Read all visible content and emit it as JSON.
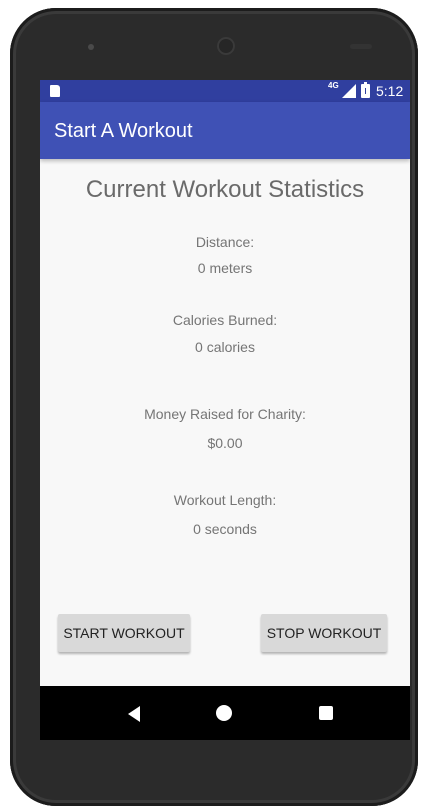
{
  "status_bar": {
    "network": "4G",
    "time": "5:12"
  },
  "app_bar": {
    "title": "Start A Workout"
  },
  "stats": {
    "heading": "Current Workout Statistics",
    "distance_label": "Distance:",
    "distance_value": "0 meters",
    "calories_label": "Calories Burned:",
    "calories_value": "0 calories",
    "money_label": "Money Raised for Charity:",
    "money_value": "$0.00",
    "length_label": "Workout Length:",
    "length_value": "0 seconds"
  },
  "buttons": {
    "start": "START WORKOUT",
    "stop": "STOP WORKOUT"
  },
  "colors": {
    "status_bar": "#303f9f",
    "app_bar": "#3f51b5",
    "background": "#f8f8f8",
    "button": "#d9d9d9"
  },
  "nav_icons": [
    "back-icon",
    "home-icon",
    "recents-icon"
  ]
}
